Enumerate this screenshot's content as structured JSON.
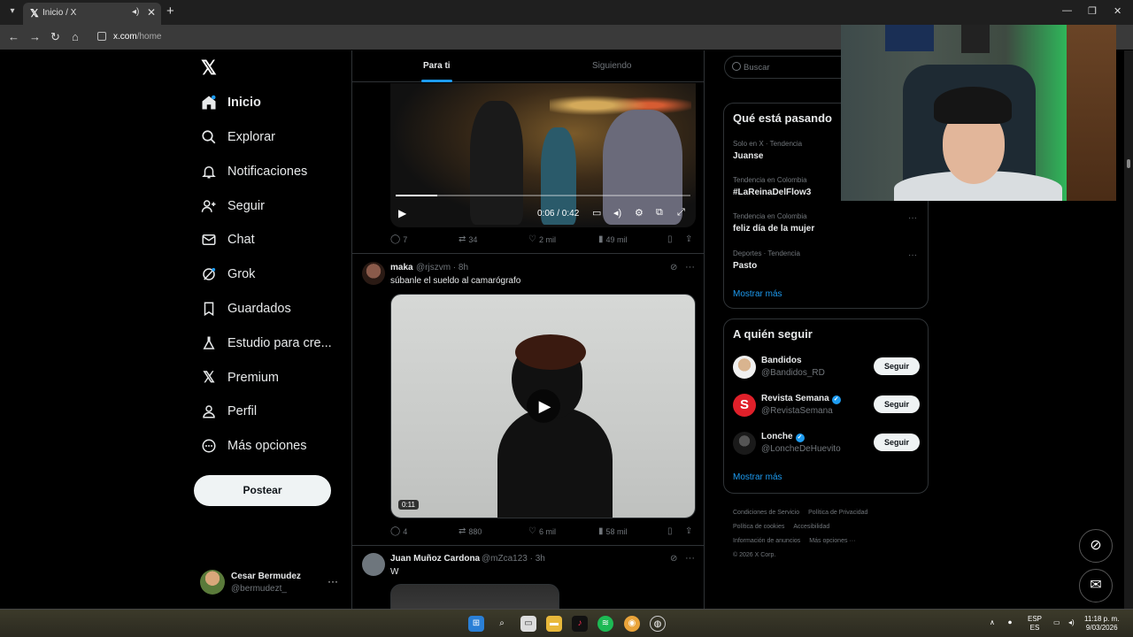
{
  "browser": {
    "tab_title": "Inicio / X",
    "url_host": "x.com",
    "url_path": "/home"
  },
  "sidebar": {
    "items": [
      {
        "label": "Inicio"
      },
      {
        "label": "Explorar"
      },
      {
        "label": "Notificaciones"
      },
      {
        "label": "Seguir"
      },
      {
        "label": "Chat"
      },
      {
        "label": "Grok"
      },
      {
        "label": "Guardados"
      },
      {
        "label": "Estudio para cre..."
      },
      {
        "label": "Premium"
      },
      {
        "label": "Perfil"
      },
      {
        "label": "Más opciones"
      }
    ],
    "post_button": "Postear",
    "account": {
      "name": "Cesar Bermudez",
      "handle": "@bermudezt_"
    }
  },
  "feed": {
    "tabs": [
      "Para ti",
      "Siguiendo"
    ],
    "post1": {
      "video_time": "0:06 / 0:42",
      "progress": 0.14,
      "replies": "7",
      "reposts": "34",
      "likes": "2 mil",
      "views": "49 mil"
    },
    "post2": {
      "name": "maka",
      "handle_time": "@rjszvm · 8h",
      "text": "súbanle el sueldo al camarógrafo",
      "duration": "0:11",
      "replies": "4",
      "reposts": "880",
      "likes": "6 mil",
      "views": "58 mil"
    },
    "post3": {
      "name": "Juan Muñoz Cardona",
      "handle_time": "@mZca123 · 3h",
      "text": "W"
    }
  },
  "right": {
    "search_placeholder": "Buscar",
    "trends_title": "Qué está pasando",
    "trends": [
      {
        "meta": "Solo en X · Tendencia",
        "name": "Juanse"
      },
      {
        "meta": "Tendencia en Colombia",
        "name": "#LaReinaDelFlow3"
      },
      {
        "meta": "Tendencia en Colombia",
        "name": "feliz día de la mujer"
      },
      {
        "meta": "Deportes · Tendencia",
        "name": "Pasto"
      }
    ],
    "trends_more": "Mostrar más",
    "who_title": "A quién seguir",
    "who": [
      {
        "name": "Bandidos",
        "handle": "@Bandidos_RD",
        "verified": false,
        "button": "Seguir"
      },
      {
        "name": "Revista Semana",
        "handle": "@RevistaSemana",
        "verified": true,
        "button": "Seguir"
      },
      {
        "name": "Lonche",
        "handle": "@LoncheDeHuevito",
        "verified": true,
        "button": "Seguir"
      }
    ],
    "who_more": "Mostrar más",
    "footer": {
      "l1": "Condiciones de Servicio",
      "l2": "Política de Privacidad",
      "l3": "Política de cookies",
      "l4": "Accesibilidad",
      "l5": "Información de anuncios",
      "l6": "Más opciones ···",
      "copyright": "© 2026 X Corp."
    }
  },
  "taskbar": {
    "lang_top": "ESP",
    "lang_bottom": "ES",
    "time": "11:18 p. m.",
    "date": "9/03/2026"
  },
  "colors": {
    "accent": "#1d9bf0",
    "background": "#000000",
    "border": "#2f3336"
  }
}
